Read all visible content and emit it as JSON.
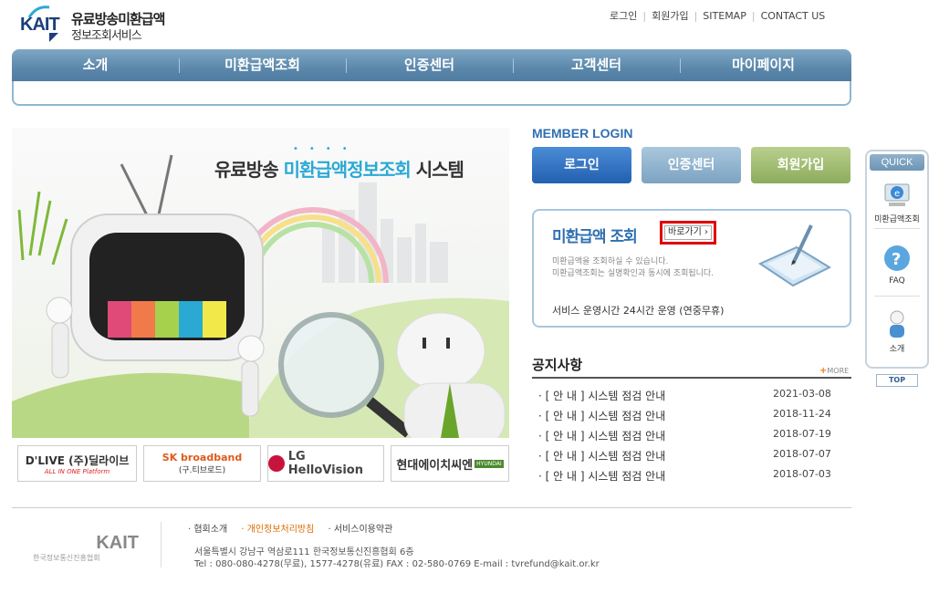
{
  "header": {
    "logo_text": "KAIT",
    "title_line1": "유료방송미환급액",
    "title_line2": "정보조회서비스",
    "util_links": [
      "로그인",
      "회원가입",
      "SITEMAP",
      "CONTACT US"
    ]
  },
  "nav": {
    "items": [
      "소개",
      "미환급액조회",
      "인증센터",
      "고객센터",
      "마이페이지"
    ]
  },
  "hero": {
    "title_prefix": "유료방송 ",
    "title_highlight": "미환급액정보조회",
    "title_suffix": " 시스템"
  },
  "partners": [
    {
      "name": "D'LIVE (주)딜라이브",
      "sub": "ALL IN ONE Platform"
    },
    {
      "name": "SK broadband",
      "sub": "(구.티브로드)"
    },
    {
      "name": "LG HelloVision"
    },
    {
      "name": "현대에이치씨엔",
      "sub": "HYUNDAI"
    }
  ],
  "member_login": {
    "title": "MEMBER LOGIN",
    "buttons": [
      "로그인",
      "인증센터",
      "회원가입"
    ]
  },
  "lookup": {
    "title": "미환급액 조회",
    "go_label": "바로가기 ›",
    "desc1": "미환급액을 조회하실 수 있습니다.",
    "desc2": "미환급액조회는 실명확인과 동시에 조회됩니다.",
    "hours": "서비스 운영시간   24시간 운영 (연중무휴)"
  },
  "notices": {
    "title": "공지사항",
    "more": "MORE",
    "items": [
      {
        "title": "· [ 안 내 ] 시스템 점검 안내",
        "date": "2021-03-08"
      },
      {
        "title": "· [ 안 내 ] 시스템 점검 안내",
        "date": "2018-11-24"
      },
      {
        "title": "· [ 안 내 ] 시스템 점검 안내",
        "date": "2018-07-19"
      },
      {
        "title": "· [ 안 내 ] 시스템 점검 안내",
        "date": "2018-07-07"
      },
      {
        "title": "· [ 안 내 ] 시스템 점검 안내",
        "date": "2018-07-03"
      }
    ]
  },
  "quick": {
    "title": "QUICK",
    "items": [
      "미환급액조회",
      "FAQ",
      "소개"
    ],
    "top": "TOP"
  },
  "footer": {
    "logo_text": "KAIT",
    "org_name": "한국정보통신진흥협회",
    "links": [
      "· 협회소개",
      "· 개인정보처리방침",
      "· 서비스이용약관"
    ],
    "address": "서울특별시 강남구 역삼로111 한국정보통신진흥협회 6층",
    "contact": "Tel : 080-080-4278(무료), 1577-4278(유료)   FAX : 02-580-0769   E-mail : tvrefund@kait.or.kr"
  },
  "colors": {
    "nav": "#5b87ab",
    "accent_blue": "#2f6fb1",
    "highlight": "#2aa9d4",
    "go_border": "#e00000"
  }
}
